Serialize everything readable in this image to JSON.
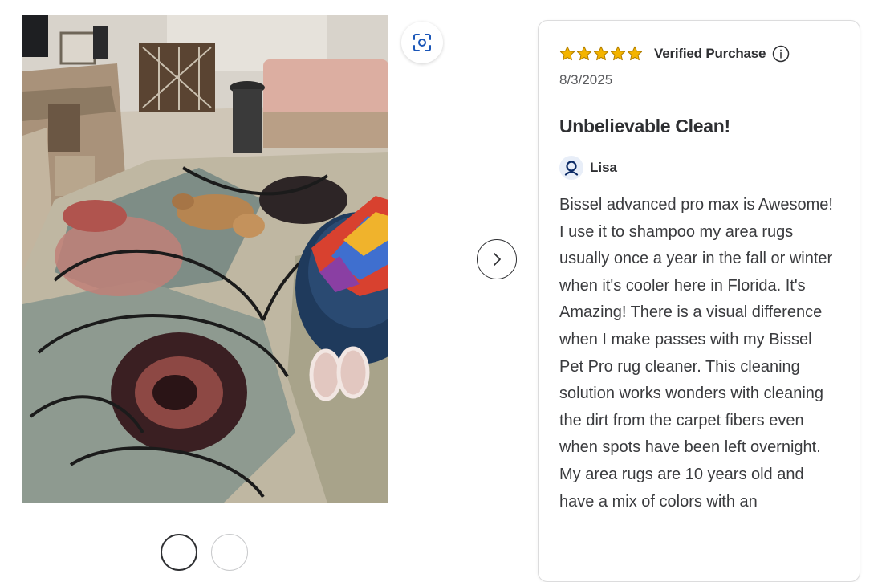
{
  "gallery": {
    "visual_search_icon": "visual-search-icon",
    "next_icon": "chevron-right-icon",
    "active_dot": 0
  },
  "review": {
    "rating": 5,
    "rating_max": 5,
    "star_color": "#f4b400",
    "verified_label": "Verified Purchase",
    "info_icon": "info-icon",
    "date": "8/3/2025",
    "title": "Unbelievable Clean!",
    "author": "Lisa",
    "body": "Bissel advanced pro max is Awesome! I use it to shampoo my area rugs usually once a year in the fall or winter when it's cooler here in Florida. It's Amazing! There is a visual difference when I make passes with my Bissel Pet Pro rug cleaner. This cleaning solution works wonders with cleaning the dirt from the carpet fibers even when spots have been left overnight. My area rugs are 10 years old and have a mix of colors with an"
  }
}
